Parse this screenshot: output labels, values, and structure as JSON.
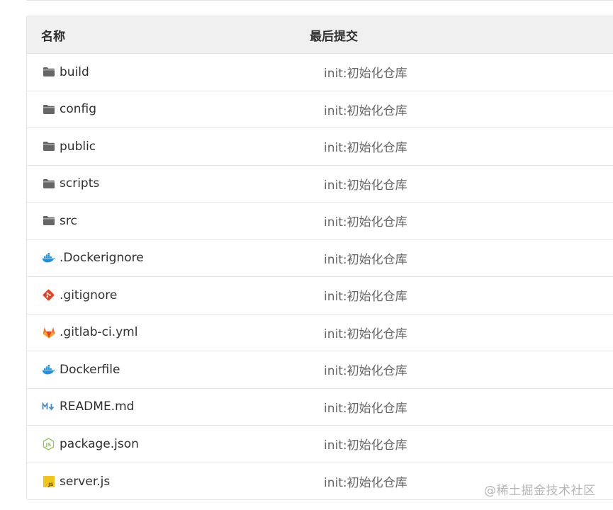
{
  "table": {
    "header": {
      "name": "名称",
      "last_commit": "最后提交"
    },
    "rows": [
      {
        "name": "build",
        "icon": "folder-icon",
        "commit": "init:初始化仓库"
      },
      {
        "name": "config",
        "icon": "folder-icon",
        "commit": "init:初始化仓库"
      },
      {
        "name": "public",
        "icon": "folder-icon",
        "commit": "init:初始化仓库"
      },
      {
        "name": "scripts",
        "icon": "folder-icon",
        "commit": "init:初始化仓库"
      },
      {
        "name": "src",
        "icon": "folder-icon",
        "commit": "init:初始化仓库"
      },
      {
        "name": ".Dockerignore",
        "icon": "docker-icon",
        "commit": "init:初始化仓库"
      },
      {
        "name": ".gitignore",
        "icon": "git-icon",
        "commit": "init:初始化仓库"
      },
      {
        "name": ".gitlab-ci.yml",
        "icon": "gitlab-icon",
        "commit": "init:初始化仓库"
      },
      {
        "name": "Dockerfile",
        "icon": "docker-icon",
        "commit": "init:初始化仓库"
      },
      {
        "name": "README.md",
        "icon": "markdown-icon",
        "commit": "init:初始化仓库"
      },
      {
        "name": "package.json",
        "icon": "nodejs-icon",
        "commit": "init:初始化仓库"
      },
      {
        "name": "server.js",
        "icon": "javascript-icon",
        "commit": "init:初始化仓库"
      }
    ]
  },
  "watermark": "@稀土掘金技术社区",
  "colors": {
    "folder": "#666666",
    "docker": "#1d91e6",
    "git": "#e24329",
    "gitlab": "#fc6d26",
    "markdown": "#4a90c2",
    "nodejs": "#8cc84b",
    "javascript": "#f0c419",
    "commit_text": "#666666",
    "header_bg": "#f0f0f0",
    "border": "#e5e5e5"
  }
}
